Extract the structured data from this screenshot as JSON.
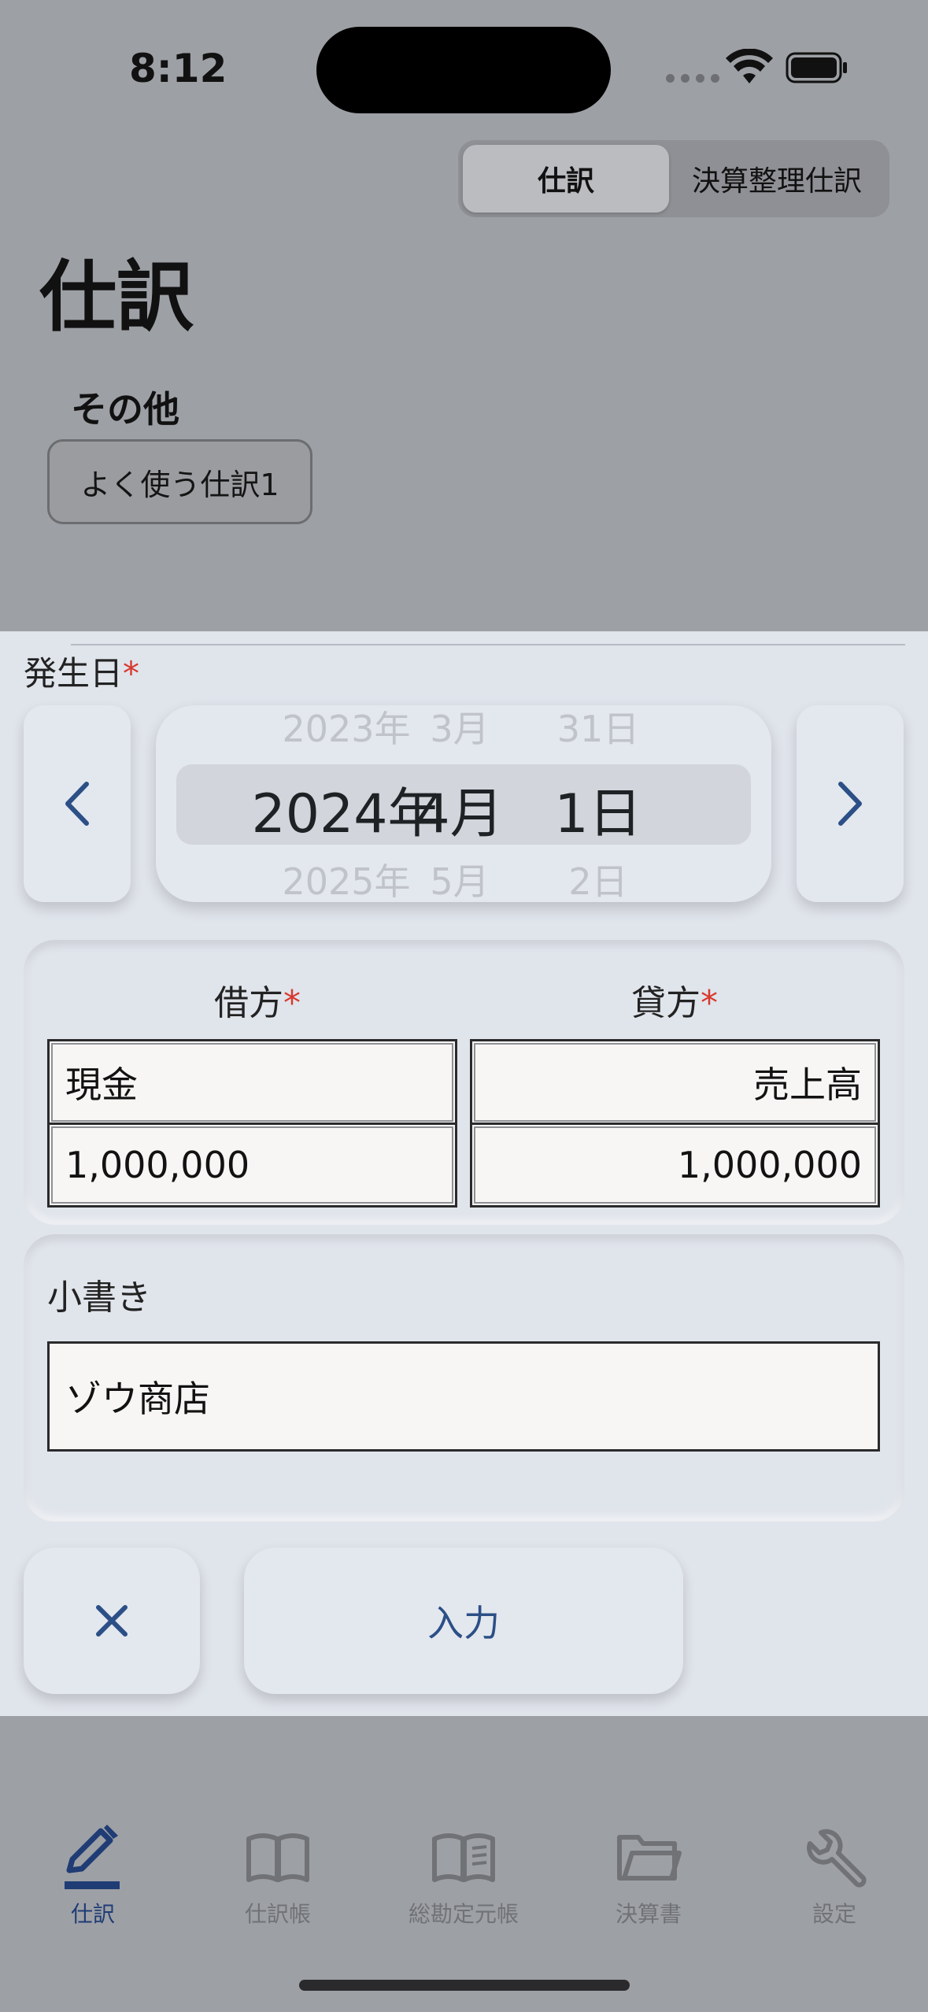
{
  "status_bar": {
    "time": "8:12"
  },
  "segment": {
    "journal": "仕訳",
    "adjusting": "決算整理仕訳"
  },
  "page_title": "仕訳",
  "other_section": {
    "title": "その他",
    "favorite_button": "よく使う仕訳1"
  },
  "date_picker": {
    "label": "発生日",
    "required_mark": "*",
    "prev_year": "2023年",
    "prev_month": "3月",
    "prev_day": "31日",
    "year": "2024年",
    "month": "4月",
    "day": "1日",
    "next_year": "2025年",
    "next_month": "5月",
    "next_day": "2日"
  },
  "journal": {
    "debit_label": "借方",
    "credit_label": "貸方",
    "required_mark": "*",
    "debit_account": "現金",
    "credit_account": "売上高",
    "debit_amount": "1,000,000",
    "credit_amount": "1,000,000"
  },
  "memo": {
    "label": "小書き",
    "value": "ゾウ商店"
  },
  "actions": {
    "submit": "入力"
  },
  "tabs": [
    {
      "label": "仕訳",
      "icon": "pencil-icon"
    },
    {
      "label": "仕訳帳",
      "icon": "book-icon"
    },
    {
      "label": "総勘定元帳",
      "icon": "ledger-book-icon"
    },
    {
      "label": "決算書",
      "icon": "folder-icon"
    },
    {
      "label": "設定",
      "icon": "wrench-icon"
    }
  ],
  "colors": {
    "accent": "#1f3c75",
    "required": "#d8382d",
    "sheet": "#e0e4eb"
  }
}
